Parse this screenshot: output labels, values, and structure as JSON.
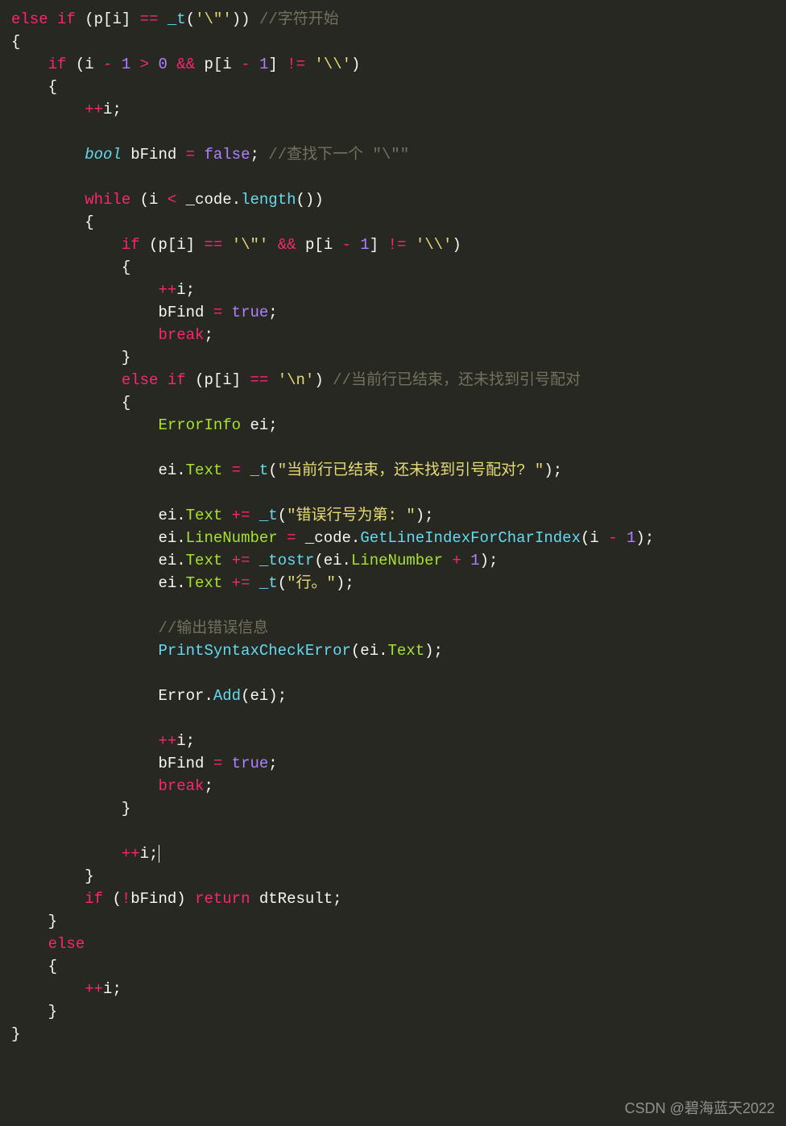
{
  "comments": {
    "c1": "//字符开始",
    "c2": "//查找下一个 \"\\\"\"",
    "c3": "//当前行已结束，还未找到引号配对",
    "c4": "//输出错误信息"
  },
  "strings": {
    "s_quote1": "'\\\"'",
    "s_backslash": "'\\\\'",
    "s_quote2": "'\\\"'",
    "s_backslash2": "'\\\\'",
    "s_newline": "'\\n'",
    "s_err1": "\"当前行已结束，还未找到引号配对? \"",
    "s_err2": "\"错误行号为第: \"",
    "s_err3": "\"行。\""
  },
  "idents": {
    "p": "p",
    "i": "i",
    "bFind": "bFind",
    "_code": "_code",
    "ei": "ei",
    "dtResult": "dtResult",
    "Error": "Error",
    "Text": "Text",
    "LineNumber": "LineNumber"
  },
  "types": {
    "bool": "bool",
    "ErrorInfo": "ErrorInfo"
  },
  "keywords": {
    "else": "else",
    "if": "if",
    "while": "while",
    "break": "break",
    "return": "return"
  },
  "literals": {
    "false": "false",
    "true": "true",
    "zero": "0",
    "one": "1"
  },
  "funcs": {
    "_t": "_t",
    "length": "length",
    "GetLineIndexForCharIndex": "GetLineIndexForCharIndex",
    "_tostr": "_tostr",
    "PrintSyntaxCheckError": "PrintSyntaxCheckError",
    "Add": "Add"
  },
  "watermark": "CSDN @碧海蓝天2022"
}
